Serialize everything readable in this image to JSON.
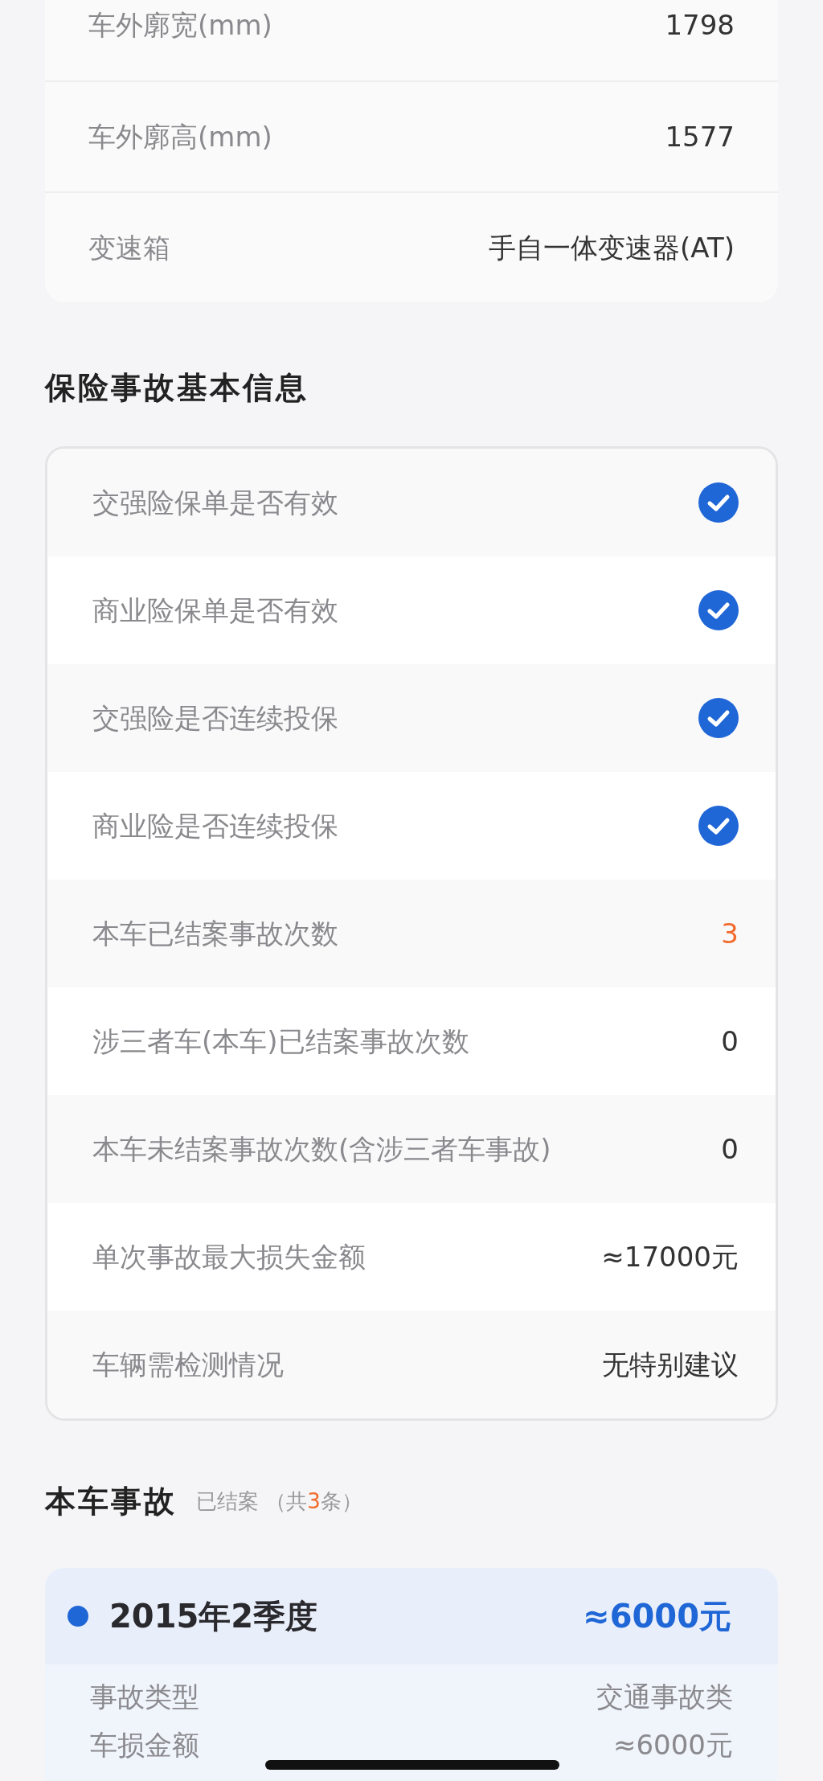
{
  "vehicle_specs": [
    {
      "label": "车外廓宽(mm)",
      "value": "1798"
    },
    {
      "label": "车外廓高(mm)",
      "value": "1577"
    },
    {
      "label": "变速箱",
      "value": "手自一体变速器(AT)"
    }
  ],
  "insurance": {
    "title": "保险事故基本信息",
    "rows": [
      {
        "kind": "check",
        "label": "交强险保单是否有效",
        "checked": true
      },
      {
        "kind": "check",
        "label": "商业险保单是否有效",
        "checked": true
      },
      {
        "kind": "check",
        "label": "交强险是否连续投保",
        "checked": true
      },
      {
        "kind": "check",
        "label": "商业险是否连续投保",
        "checked": true
      },
      {
        "kind": "text",
        "label": "本车已结案事故次数",
        "value": "3",
        "highlight": true
      },
      {
        "kind": "text",
        "label": "涉三者车(本车)已结案事故次数",
        "value": "0",
        "highlight": false
      },
      {
        "kind": "text",
        "label": "本车未结案事故次数(含涉三者车事故)",
        "value": "0",
        "highlight": false
      },
      {
        "kind": "text",
        "label": "单次事故最大损失金额",
        "value": "≈17000元",
        "highlight": false
      },
      {
        "kind": "text",
        "label": "车辆需检测情况",
        "value": "无特别建议",
        "highlight": false
      }
    ]
  },
  "accidents": {
    "title": "本车事故",
    "status": "已结案",
    "count_prefix": "（共",
    "count": "3",
    "count_suffix": "条）",
    "items": [
      {
        "color": "#1f66d6",
        "period": "2015年2季度",
        "amount": "≈6000元",
        "details": [
          {
            "label": "事故类型",
            "value": "交通事故类"
          },
          {
            "label": "车损金额",
            "value": "≈6000元"
          }
        ]
      }
    ]
  }
}
